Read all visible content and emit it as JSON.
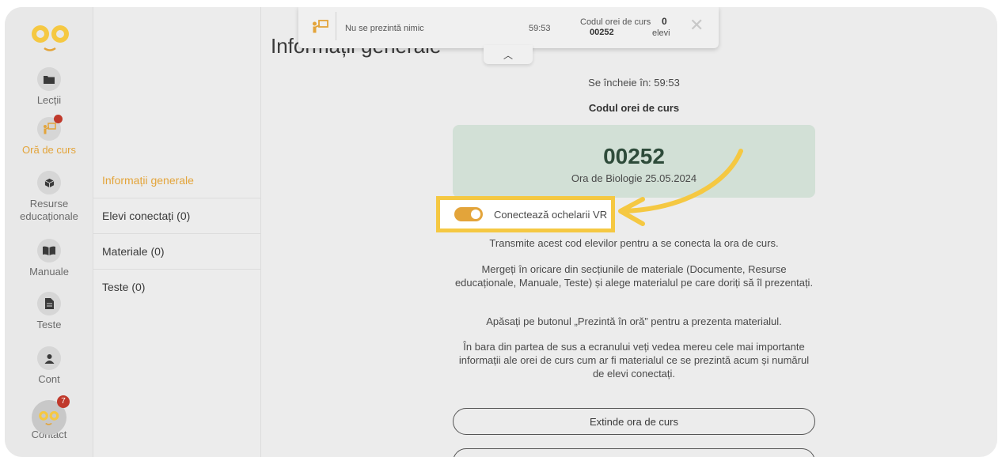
{
  "rail": {
    "items": [
      {
        "label": "Lecții",
        "icon": "folder-icon"
      },
      {
        "label": "Oră de curs",
        "icon": "presenter-icon",
        "active": true
      },
      {
        "label": "Resurse educaționale",
        "icon": "cube-icon"
      },
      {
        "label": "Manuale",
        "icon": "book-icon"
      },
      {
        "label": "Teste",
        "icon": "document-icon"
      },
      {
        "label": "Cont",
        "icon": "user-icon"
      },
      {
        "label": "Contact",
        "icon": "logo-chat-icon",
        "badge": "7"
      }
    ]
  },
  "subnav": {
    "items": [
      {
        "label": "Informații generale"
      },
      {
        "label": "Elevi conectați (0)"
      },
      {
        "label": "Materiale (0)"
      },
      {
        "label": "Teste (0)"
      }
    ]
  },
  "topbar": {
    "status": "Nu se prezintă nimic",
    "time": "59:53",
    "code_label": "Codul orei de curs",
    "code": "00252",
    "student_count": "0",
    "students_label": "elevi"
  },
  "main": {
    "heading": "Informații generale",
    "ends_in": "Se încheie în: 59:53",
    "code_heading": "Codul orei de curs",
    "code": "00252",
    "class_name": "Ora de Biologie 25.05.2024",
    "vr_toggle_label": "Conectează ochelarii VR",
    "para1": "Transmite acest cod elevilor pentru a se conecta la ora de curs.",
    "para2": "Mergeți în oricare din secțiunile de materiale (Documente, Resurse educaționale, Manuale, Teste) și alege materialul pe care doriți să îl prezentați.",
    "para3": "Apăsați pe butonul „Prezintă în oră” pentru a prezenta materialul.",
    "para4": "În bara din partea de sus a ecranului veți vedea mereu cele mai importante informații ale orei de curs cum ar fi materialul ce se prezintă acum și numărul de elevi conectați.",
    "extend_button": "Extinde ora de curs"
  },
  "colors": {
    "accent": "#e3a43a",
    "highlight": "#f5c842",
    "code_box": "#d2e0d6"
  }
}
